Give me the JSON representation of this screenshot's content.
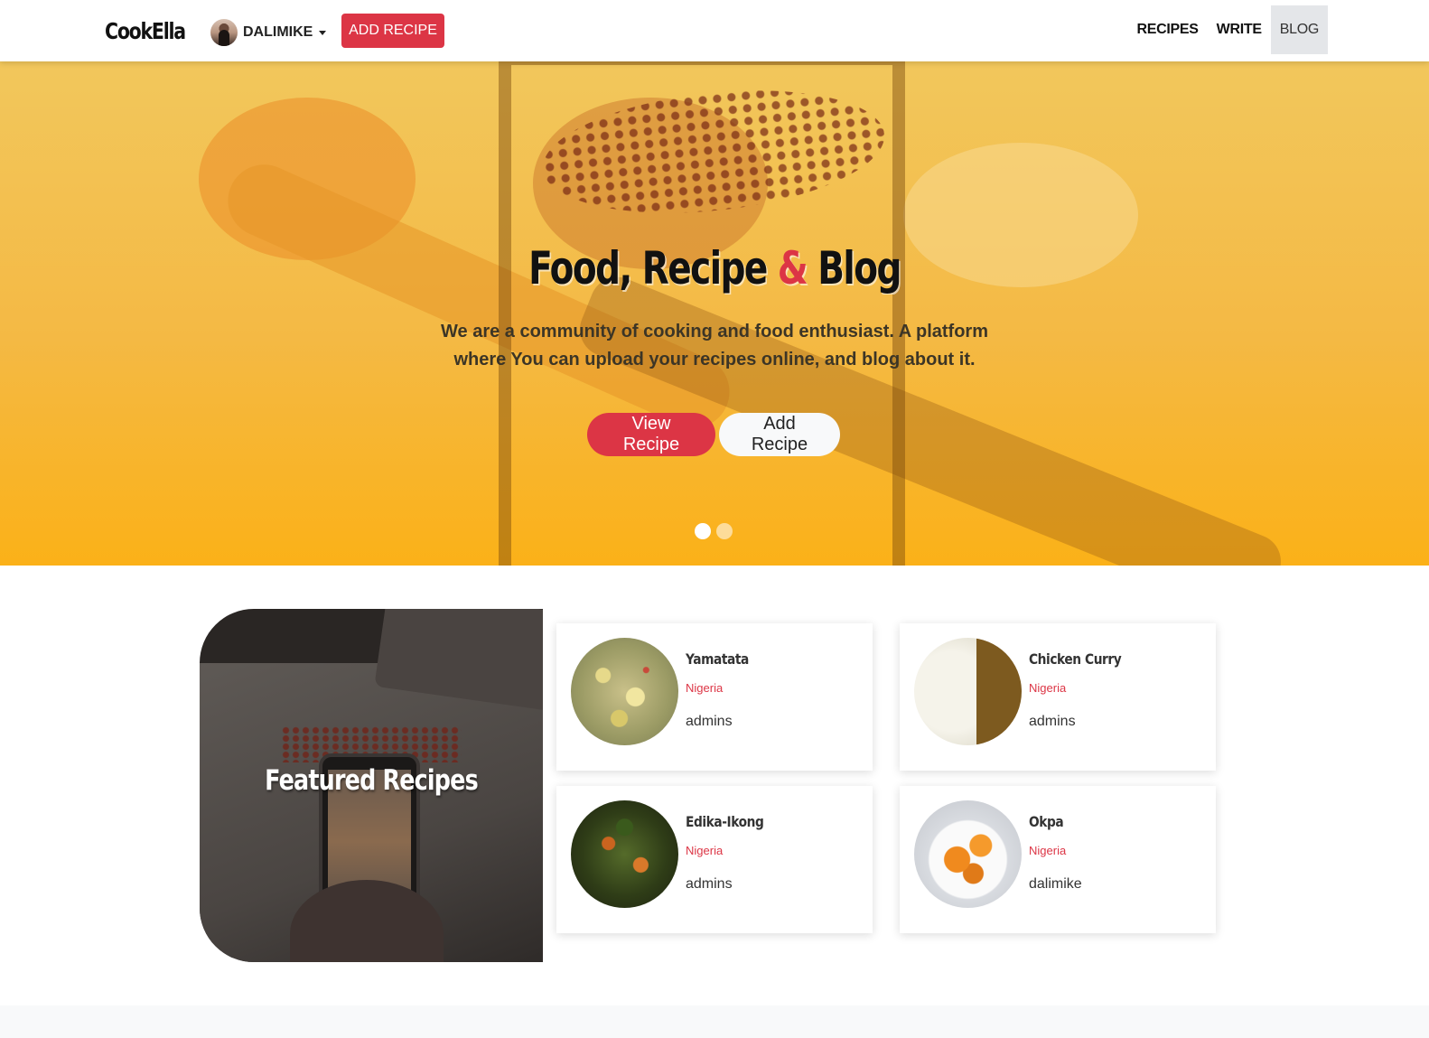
{
  "navbar": {
    "brand": "CookElla",
    "user_name": "DALIMIKE",
    "add_recipe_label": "ADD RECIPE",
    "links": [
      {
        "label": "RECIPES"
      },
      {
        "label": "WRITE"
      },
      {
        "label": "BLOG",
        "active": true
      }
    ]
  },
  "hero": {
    "title_part1": "Food, Recipe ",
    "title_amp": "&",
    "title_part2": " Blog",
    "subtitle": "We are a community of cooking and food enthusiast. A platform where You can upload your recipes online, and blog about it.",
    "view_button": "View Recipe",
    "add_button": "Add Recipe",
    "slides": 2,
    "active_slide": 1
  },
  "featured": {
    "title": "Featured Recipes",
    "cards": [
      {
        "name": "Yamatata",
        "country": "Nigeria",
        "author": "admins"
      },
      {
        "name": "Chicken Curry",
        "country": "Nigeria",
        "author": "admins"
      },
      {
        "name": "Edika-Ikong",
        "country": "Nigeria",
        "author": "admins"
      },
      {
        "name": "Okpa",
        "country": "Nigeria",
        "author": "dalimike"
      }
    ]
  },
  "colors": {
    "accent": "#dc3545",
    "hero_overlay": "#fbb118",
    "nav_active_bg": "#e4e6e9"
  }
}
